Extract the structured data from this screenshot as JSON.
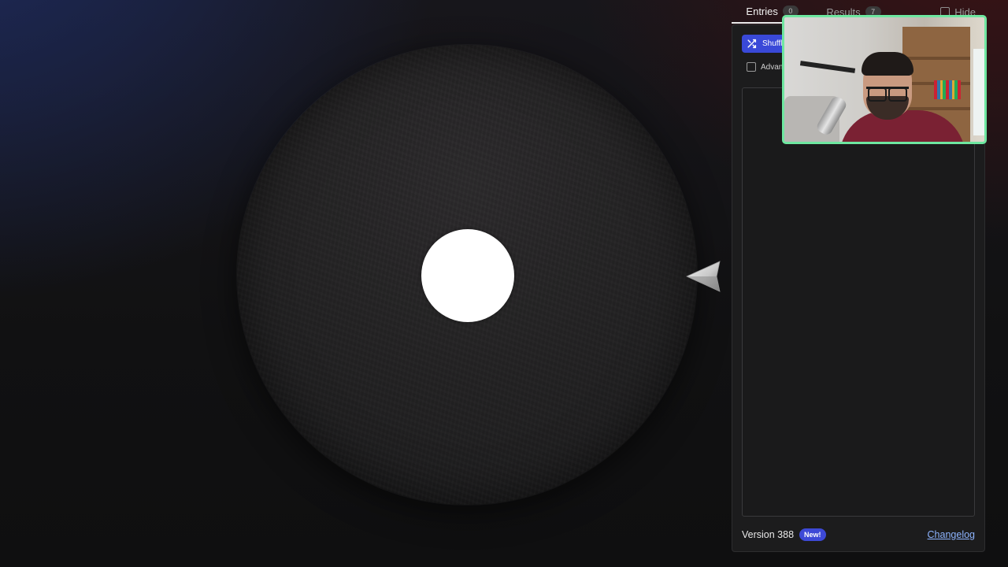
{
  "tabs": [
    {
      "label": "Entries",
      "count": "0",
      "active": true
    },
    {
      "label": "Results",
      "count": "7",
      "active": false
    }
  ],
  "hide": {
    "label": "Hide"
  },
  "panel": {
    "shuffle_label": "Shuffle",
    "advanced_label": "Advanced",
    "entries_text": ""
  },
  "footer": {
    "version": "Version 388",
    "new_badge": "New!",
    "changelog": "Changelog"
  },
  "colors": {
    "accent": "#3949d8",
    "webcam_border": "#6ee7a0",
    "link": "#8db4ff"
  },
  "icons": {
    "shuffle": "shuffle-icon",
    "pointer": "wheel-pointer-icon",
    "checkbox": "checkbox-icon"
  }
}
